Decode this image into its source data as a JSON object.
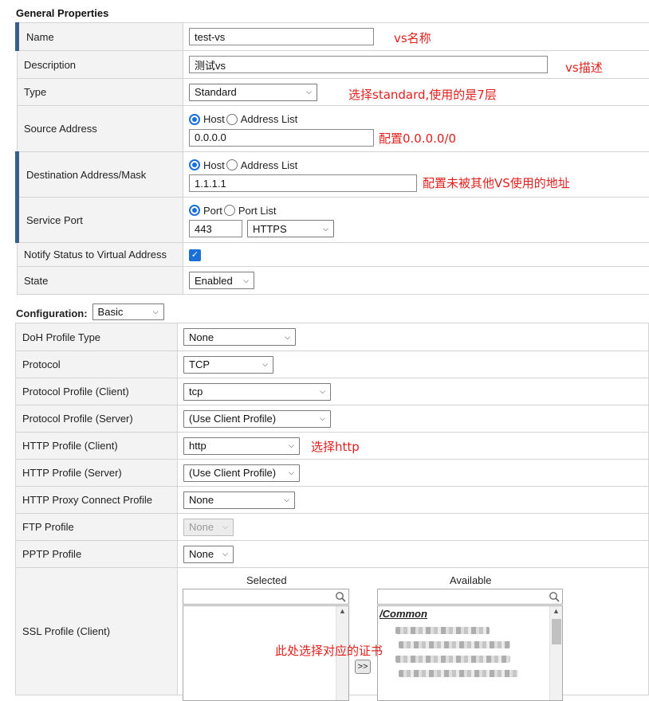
{
  "general": {
    "title": "General Properties",
    "name": {
      "label": "Name",
      "value": "test-vs"
    },
    "description": {
      "label": "Description",
      "value": "测试vs"
    },
    "type": {
      "label": "Type",
      "value": "Standard"
    },
    "source": {
      "label": "Source Address",
      "radio_host": "Host",
      "radio_list": "Address List",
      "value": "0.0.0.0"
    },
    "destination": {
      "label": "Destination Address/Mask",
      "radio_host": "Host",
      "radio_list": "Address List",
      "value": "1.1.1.1"
    },
    "service_port": {
      "label": "Service Port",
      "radio_port": "Port",
      "radio_list": "Port List",
      "port": "443",
      "protocol": "HTTPS"
    },
    "notify": {
      "label": "Notify Status to Virtual Address",
      "checked": "✓"
    },
    "state": {
      "label": "State",
      "value": "Enabled"
    }
  },
  "configuration": {
    "title": "Configuration:",
    "mode": "Basic",
    "rows": {
      "doh": {
        "label": "DoH Profile Type",
        "value": "None"
      },
      "protocol": {
        "label": "Protocol",
        "value": "TCP"
      },
      "pp_client": {
        "label": "Protocol Profile (Client)",
        "value": "tcp"
      },
      "pp_server": {
        "label": "Protocol Profile (Server)",
        "value": "(Use Client Profile)"
      },
      "http_client": {
        "label": "HTTP Profile (Client)",
        "value": "http"
      },
      "http_server": {
        "label": "HTTP Profile (Server)",
        "value": "(Use Client Profile)"
      },
      "http_proxy": {
        "label": "HTTP Proxy Connect Profile",
        "value": "None"
      },
      "ftp": {
        "label": "FTP Profile",
        "value": "None"
      },
      "pptp": {
        "label": "PPTP Profile",
        "value": "None"
      },
      "ssl_client": {
        "label": "SSL Profile (Client)",
        "selected_header": "Selected",
        "available_header": "Available",
        "available_group": "/Common",
        "move_button": ">>"
      }
    }
  },
  "annotations": {
    "name": "vs名称",
    "description": "vs描述",
    "type": "选择standard,使用的是7层",
    "source": "配置0.0.0.0/0",
    "destination": "配置未被其他VS使用的地址",
    "http": "选择http",
    "ssl": "此处选择对应的证书"
  },
  "colors": {
    "annotation": "#e0201e",
    "required_bar": "#3a5f8e",
    "accent": "#1a6fd8"
  }
}
